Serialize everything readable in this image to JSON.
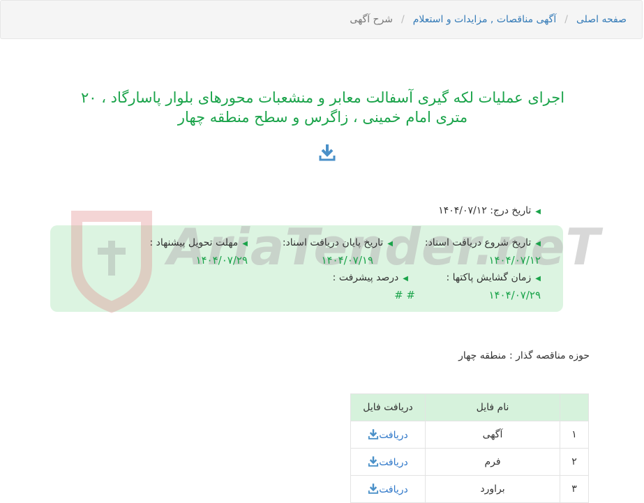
{
  "breadcrumb": {
    "home": "صفحه اصلی",
    "section": "آگهی مناقصات , مزایدات و استعلام",
    "current": "شرح آگهی",
    "separator": "/"
  },
  "title": "اجرای عملیات لکه گیری آسفالت معابر و منشعبات محورهای بلوار پاسارگاد ، ۲۰ متری امام خمینی ، زاگرس و سطح منطقه چهار",
  "watermark": "AriaTender.neT",
  "info": {
    "insert_date_label": "تاریخ درج:",
    "insert_date": "۱۴۰۴/۰۷/۱۲",
    "doc_start_label": "تاریخ شروع دریافت اسناد:",
    "doc_start": "۱۴۰۴/۰۷/۱۲",
    "doc_end_label": "تاریخ پایان دریافت اسناد:",
    "doc_end": "۱۴۰۴/۰۷/۱۹",
    "deadline_label": "مهلت تحویل پیشنهاد :",
    "deadline": "۱۴۰۴/۰۷/۲۹",
    "opening_label": "زمان گشایش پاکتها :",
    "opening": "۱۴۰۴/۰۷/۲۹",
    "progress_label": "درصد پیشرفت :",
    "progress": "# #"
  },
  "organizer": "حوزه مناقصه گذار : منطقه چهار",
  "files": {
    "headers": [
      "",
      "نام فایل",
      "دریافت فایل"
    ],
    "rows": [
      {
        "index": "۱",
        "name": "آگهی",
        "action": "دریافت"
      },
      {
        "index": "۲",
        "name": "فرم",
        "action": "دریافت"
      },
      {
        "index": "۳",
        "name": "براورد",
        "action": "دریافت"
      }
    ]
  },
  "colors": {
    "accent": "#1aa34a",
    "link": "#337ab7",
    "box": "#d6f2dc"
  },
  "icons": {
    "download": "download-icon",
    "bullet": "triangle-left-icon"
  }
}
